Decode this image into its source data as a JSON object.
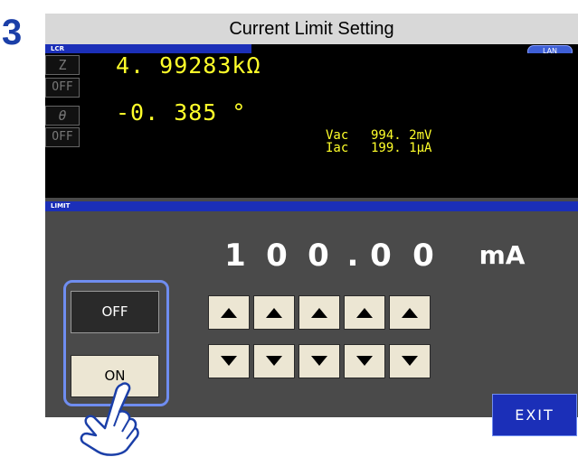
{
  "step_number": "3",
  "window": {
    "title": "Current Limit Setting"
  },
  "lcr_bar": {
    "tag": "LCR",
    "lan_label": "LAN"
  },
  "measurement": {
    "param1": {
      "symbol": "Z",
      "value": "4. 99283kΩ",
      "state": "OFF"
    },
    "param2": {
      "symbol": "θ",
      "value": "-0. 385 °",
      "state": "OFF"
    },
    "monitor": {
      "vac_label": "Vac",
      "vac_value": "994. 2mV",
      "iac_label": "Iac",
      "iac_value": "199. 1μA"
    }
  },
  "limit": {
    "tag": "LIMIT",
    "digits": [
      "1",
      "0",
      "0",
      ".",
      "0",
      "0"
    ],
    "unit": "mA",
    "off_label": "OFF",
    "on_label": "ON"
  },
  "exit_label": "EXIT",
  "colors": {
    "accent_blue": "#1b2fb8",
    "value_yellow": "#ffff2a",
    "button_beige": "#ece6d3"
  },
  "icons": {
    "up": "triangle-up-icon",
    "down": "triangle-down-icon",
    "hand": "pointing-hand-icon"
  }
}
